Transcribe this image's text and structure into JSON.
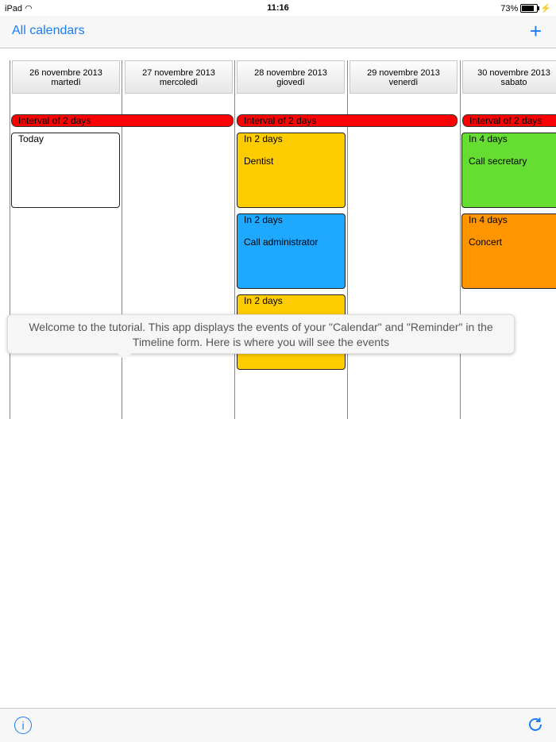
{
  "status": {
    "device": "iPad",
    "time": "11:16",
    "battery": "73%",
    "battery_level": 0.73
  },
  "nav": {
    "back_label": "All calendars",
    "add_label": "+"
  },
  "days": [
    {
      "date": "26 novembre 2013",
      "weekday": "martedì"
    },
    {
      "date": "27 novembre 2013",
      "weekday": "mercoledì"
    },
    {
      "date": "28 novembre 2013",
      "weekday": "giovedì"
    },
    {
      "date": "29 novembre 2013",
      "weekday": "venerdì"
    },
    {
      "date": "30 novembre 2013",
      "weekday": "sabato"
    }
  ],
  "intervals": [
    {
      "label": "Interval of 2 days",
      "color": "#ff0000"
    },
    {
      "label": "Interval of 2 days",
      "color": "#ff0000"
    },
    {
      "label": "Interval of 2 days",
      "color": "#ff0000"
    }
  ],
  "events": [
    {
      "top": "Today",
      "title": "",
      "color": "#ffffff"
    },
    {
      "top": "In 2 days",
      "title": "Dentist",
      "color": "#ffcc00"
    },
    {
      "top": "In 2 days",
      "title": "Call administrator",
      "color": "#1ea8ff"
    },
    {
      "top": "In 2 days",
      "title": "",
      "color": "#ffcc00"
    },
    {
      "top": "In 4 days",
      "title": "Call secretary",
      "color": "#66dd33"
    },
    {
      "top": "In 4 days",
      "title": "Concert",
      "color": "#ff9500"
    }
  ],
  "tooltip": {
    "text": "Welcome to the tutorial. This app displays the events of your \"Calendar\" and \"Reminder\" in the Timeline form. Here is where you will see the events"
  },
  "toolbar": {
    "info_label": "i"
  }
}
